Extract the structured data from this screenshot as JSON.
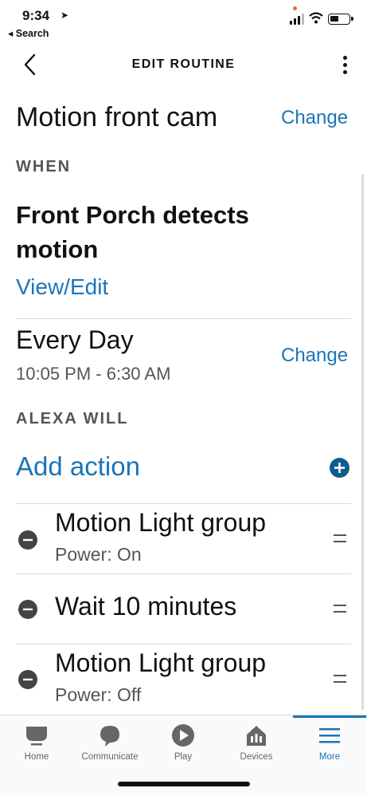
{
  "status_bar": {
    "time": "9:34",
    "back_app": "◂ Search"
  },
  "header": {
    "title": "EDIT ROUTINE"
  },
  "routine": {
    "name": "Motion front cam",
    "change_label": "Change"
  },
  "when": {
    "heading": "WHEN",
    "trigger": "Front Porch detects motion",
    "view_edit_label": "View/Edit"
  },
  "schedule": {
    "label": "Every Day",
    "time_range": "10:05 PM - 6:30 AM",
    "change_label": "Change"
  },
  "alexa_will": {
    "heading": "ALEXA WILL",
    "add_action_label": "Add action",
    "actions": [
      {
        "title": "Motion Light group",
        "subtitle": "Power: On"
      },
      {
        "title": "Wait 10 minutes",
        "subtitle": ""
      },
      {
        "title": "Motion Light group",
        "subtitle": "Power: Off"
      }
    ]
  },
  "tabs": [
    {
      "label": "Home",
      "icon": "home-icon"
    },
    {
      "label": "Communicate",
      "icon": "chat-bubble-icon"
    },
    {
      "label": "Play",
      "icon": "play-icon"
    },
    {
      "label": "Devices",
      "icon": "devices-icon"
    },
    {
      "label": "More",
      "icon": "menu-icon",
      "active": true
    }
  ],
  "colors": {
    "accent": "#1a75b8",
    "text": "#111111",
    "muted": "#555555"
  }
}
